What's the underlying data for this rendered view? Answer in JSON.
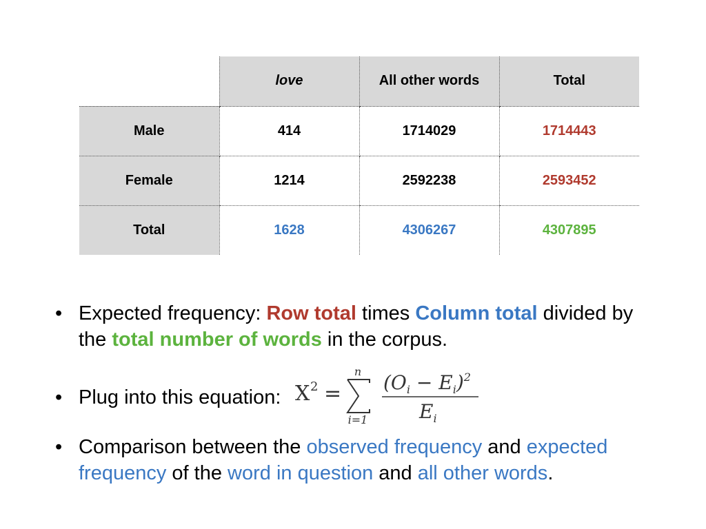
{
  "table": {
    "col_headers": [
      "love",
      "All other words",
      "Total"
    ],
    "rows": [
      {
        "label": "Male",
        "cells": [
          "414",
          "1714029",
          "1714443"
        ]
      },
      {
        "label": "Female",
        "cells": [
          "1214",
          "2592238",
          "2593452"
        ]
      },
      {
        "label": "Total",
        "cells": [
          "1628",
          "4306267",
          "4307895"
        ]
      }
    ],
    "colors": {
      "row_total": "#b03a2e",
      "col_total": "#3a78c3",
      "grand_total": "#5cb33e",
      "header_bg": "#d8d8d8"
    }
  },
  "bullets": {
    "b1": {
      "t1": "Expected frequency: ",
      "t2": "Row total",
      "t3": " times ",
      "t4": "Column total",
      "t5": " divided by the ",
      "t6": "total number of words",
      "t7": " in the corpus."
    },
    "b2": {
      "t1": "Plug into this equation:"
    },
    "b3": {
      "t1": "Comparison between the ",
      "t2": "observed frequency",
      "t3": " and ",
      "t4": "expected frequency",
      "t5": " of the ",
      "t6": "word in question",
      "t7": " and ",
      "t8": "all other words",
      "t9": "."
    }
  },
  "equation": {
    "lhs": "X",
    "lhs_sup": "2",
    "eq": "=",
    "sum_top": "n",
    "sum_bottom": "i=1",
    "numerator": "(O",
    "num_sub1": "i",
    "num_mid": " − E",
    "num_sub2": "i",
    "num_close": ")",
    "num_sup": "2",
    "denominator": "E",
    "den_sub": "i"
  }
}
